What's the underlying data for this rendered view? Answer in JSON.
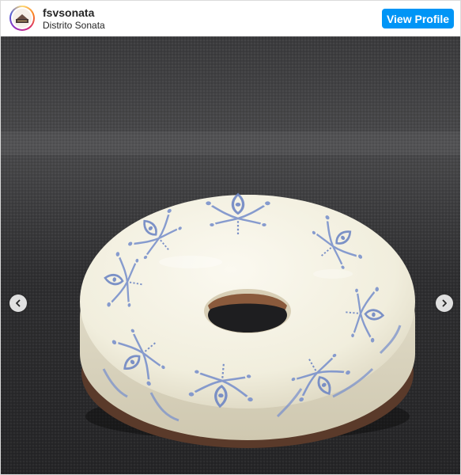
{
  "header": {
    "username": "fsvsonata",
    "location": "Distrito Sonata",
    "view_profile_label": "View Profile",
    "avatar_icon": "shop-logo-icon"
  },
  "media": {
    "subject": "white glazed donut with blue damask pattern",
    "prev_icon": "chevron-left-icon",
    "next_icon": "chevron-right-icon"
  },
  "colors": {
    "button": "#0095f6",
    "background_cloth": "#3f3f41",
    "glaze": "#f4f1e3",
    "pattern_blue": "#6f87c4"
  }
}
